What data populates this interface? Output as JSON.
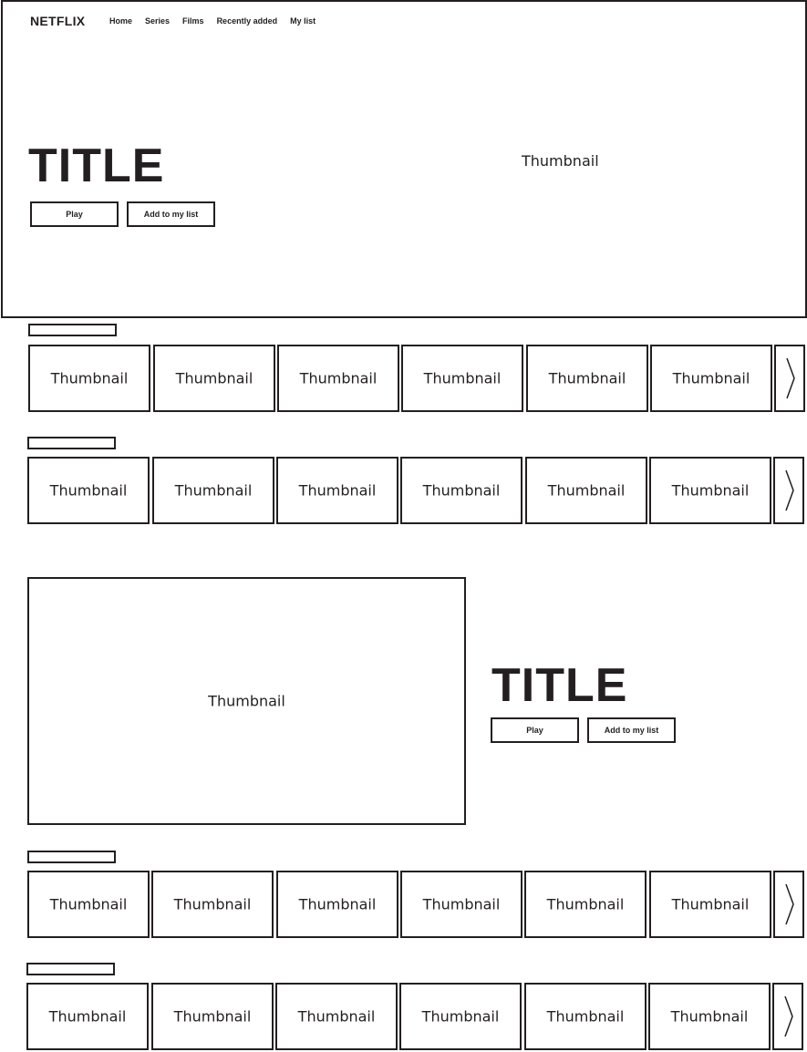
{
  "app": {
    "logo": "NETFLIX"
  },
  "nav": {
    "items": [
      "Home",
      "Series",
      "Films",
      "Recently added",
      "My list"
    ]
  },
  "hero": {
    "title": "TITLE",
    "play_label": "Play",
    "add_label": "Add to my list",
    "thumbnail_label": "Thumbnail"
  },
  "rows": [
    {
      "tiles": [
        "Thumbnail",
        "Thumbnail",
        "Thumbnail",
        "Thumbnail",
        "Thumbnail",
        "Thumbnail"
      ]
    },
    {
      "tiles": [
        "Thumbnail",
        "Thumbnail",
        "Thumbnail",
        "Thumbnail",
        "Thumbnail",
        "Thumbnail"
      ]
    },
    {
      "tiles": [
        "Thumbnail",
        "Thumbnail",
        "Thumbnail",
        "Thumbnail",
        "Thumbnail",
        "Thumbnail"
      ]
    },
    {
      "tiles": [
        "Thumbnail",
        "Thumbnail",
        "Thumbnail",
        "Thumbnail",
        "Thumbnail",
        "Thumbnail"
      ]
    }
  ],
  "feature": {
    "title": "TITLE",
    "play_label": "Play",
    "add_label": "Add to my list",
    "thumbnail_label": "Thumbnail"
  }
}
